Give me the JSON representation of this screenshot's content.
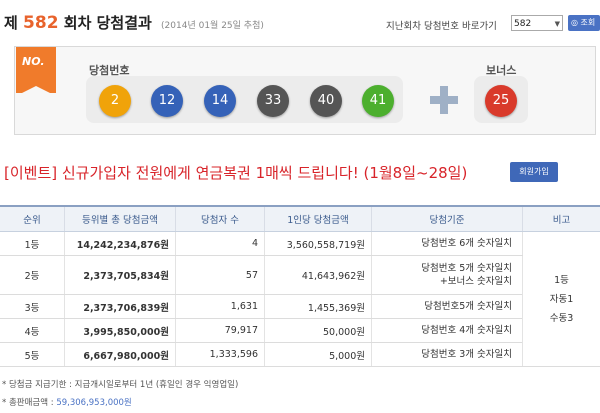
{
  "header": {
    "title_prefix": "제",
    "round": "582",
    "title_suffix": "회차 당첨결과",
    "date": "(2014년 01월 25일 추첨)",
    "goto_label": "지난회차 당첨번호 바로가기",
    "goto_value": "582",
    "goto_button": "조회"
  },
  "draw": {
    "flag": "NO.",
    "winning_label": "당첨번호",
    "bonus_label": "보너스",
    "numbers": [
      "2",
      "12",
      "14",
      "33",
      "40",
      "41"
    ],
    "ball_colors": [
      "#f0a30a",
      "#3562b8",
      "#3562b8",
      "#555555",
      "#555555",
      "#4caf2e"
    ],
    "bonus": "25",
    "bonus_color": "#d93a2b"
  },
  "event": {
    "text": "[이벤트] 신규가입자 전원에게 연금복권 1매씩 드립니다! (1월8일~28일)",
    "button": "회원가입"
  },
  "table": {
    "headers": [
      "순위",
      "등위별 총 당첨금액",
      "당첨자 수",
      "1인당 당첨금액",
      "당첨기준",
      "비고"
    ],
    "rows": [
      {
        "rank": "1등",
        "total": "14,242,234,876원",
        "winners": "4",
        "per": "3,560,558,719원",
        "crit1": "당첨번호 6개 숫자일치",
        "crit2": ""
      },
      {
        "rank": "2등",
        "total": "2,373,705,834원",
        "winners": "57",
        "per": "41,643,962원",
        "crit1": "당첨번호 5개 숫자일치",
        "crit2": "+보너스 숫자일치"
      },
      {
        "rank": "3등",
        "total": "2,373,706,839원",
        "winners": "1,631",
        "per": "1,455,369원",
        "crit1": "당첨번호5개 숫자일치",
        "crit2": ""
      },
      {
        "rank": "4등",
        "total": "3,995,850,000원",
        "winners": "79,917",
        "per": "50,000원",
        "crit1": "당첨번호 4개 숫자일치",
        "crit2": ""
      },
      {
        "rank": "5등",
        "total": "6,667,980,000원",
        "winners": "1,333,596",
        "per": "5,000원",
        "crit1": "당첨번호 3개 숫자일치",
        "crit2": ""
      }
    ],
    "note": [
      "1등",
      "자동1",
      "수동3"
    ]
  },
  "footer": {
    "deadline": "* 당첨금 지급기한 : 지급개시일로부터 1년 (휴일인 경우 익영업일)",
    "sales_label": "* 총판매금액 : ",
    "sales_value": "59,306,953,000원"
  }
}
